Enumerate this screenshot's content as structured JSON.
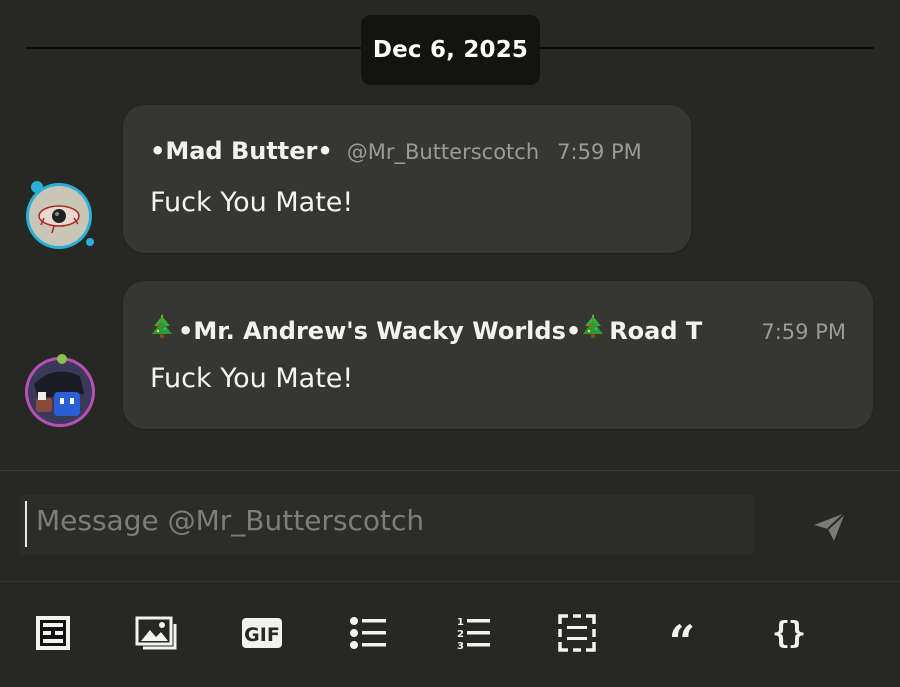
{
  "date_divider": "Dec 6, 2025",
  "messages": [
    {
      "display_name": "•Mad Butter•",
      "handle": "@Mr_Butterscotch",
      "time": "7:59 PM",
      "text": "Fuck You Mate!",
      "avatar_icon": "eye-avatar"
    },
    {
      "display_name": "•Mr. Andrew's Wacky Worlds•",
      "name_suffix": "Road T",
      "time": "7:59 PM",
      "text": "Fuck You Mate!",
      "avatar_icon": "character-avatar",
      "name_icon": "christmas-tree-icon"
    }
  ],
  "composer": {
    "placeholder": "Message @Mr_Butterscotch"
  },
  "toolbar": {
    "gif_label": "GIF",
    "quote_glyph": "“",
    "code_glyph": "{}",
    "items": [
      "formatting-icon",
      "image-icon",
      "gif-icon",
      "bullet-list-icon",
      "numbered-list-icon",
      "spoiler-icon",
      "quote-icon",
      "code-icon"
    ]
  },
  "colors": {
    "background": "#272724",
    "bubble": "#363632",
    "date_pill": "#131312",
    "muted_text": "#9a9a96"
  }
}
